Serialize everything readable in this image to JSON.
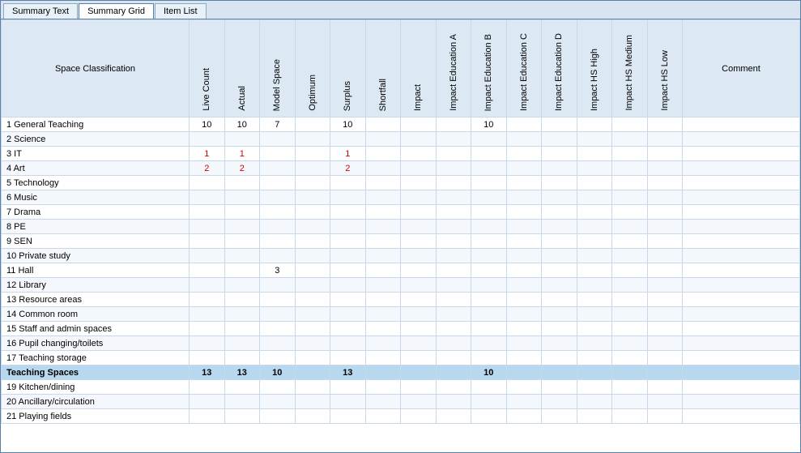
{
  "tabs": [
    {
      "label": "Summary Text",
      "active": false
    },
    {
      "label": "Summary Grid",
      "active": true
    },
    {
      "label": "Item List",
      "active": false
    }
  ],
  "table": {
    "headers": {
      "space_classification": "Space Classification",
      "live_count": "Live Count",
      "actual": "Actual",
      "model_space": "Model Space",
      "optimum": "Optimum",
      "surplus": "Surplus",
      "shortfall": "Shortfall",
      "impact": "Impact",
      "impact_edu_a": "Impact Education A",
      "impact_edu_b": "Impact Education B",
      "impact_edu_c": "Impact Education C",
      "impact_edu_d": "Impact Education D",
      "impact_hs_high": "Impact HS High",
      "impact_hs_medium": "Impact HS Medium",
      "impact_hs_low": "Impact HS Low",
      "comment": "Comment"
    },
    "rows": [
      {
        "id": "1",
        "label": "1 General Teaching",
        "live_count": "10",
        "actual": "10",
        "model_space": "7",
        "optimum": "",
        "surplus": "10",
        "shortfall": "",
        "impact": "",
        "edu_a": "",
        "edu_b": "10",
        "edu_c": "",
        "edu_d": "",
        "hs_high": "",
        "hs_medium": "",
        "hs_low": "",
        "comment": "",
        "highlight": false,
        "red": false
      },
      {
        "id": "2",
        "label": "2 Science",
        "live_count": "",
        "actual": "",
        "model_space": "",
        "optimum": "",
        "surplus": "",
        "shortfall": "",
        "impact": "",
        "edu_a": "",
        "edu_b": "",
        "edu_c": "",
        "edu_d": "",
        "hs_high": "",
        "hs_medium": "",
        "hs_low": "",
        "comment": "",
        "highlight": false
      },
      {
        "id": "3",
        "label": "3 IT",
        "live_count": "1",
        "actual": "1",
        "model_space": "",
        "optimum": "",
        "surplus": "1",
        "shortfall": "",
        "impact": "",
        "edu_a": "",
        "edu_b": "",
        "edu_c": "",
        "edu_d": "",
        "hs_high": "",
        "hs_medium": "",
        "hs_low": "",
        "comment": "",
        "highlight": false,
        "red": true
      },
      {
        "id": "4",
        "label": "4 Art",
        "live_count": "2",
        "actual": "2",
        "model_space": "",
        "optimum": "",
        "surplus": "2",
        "shortfall": "",
        "impact": "",
        "edu_a": "",
        "edu_b": "",
        "edu_c": "",
        "edu_d": "",
        "hs_high": "",
        "hs_medium": "",
        "hs_low": "",
        "comment": "",
        "highlight": false,
        "red": true
      },
      {
        "id": "5",
        "label": "5 Technology",
        "live_count": "",
        "actual": "",
        "model_space": "",
        "optimum": "",
        "surplus": "",
        "shortfall": "",
        "impact": "",
        "edu_a": "",
        "edu_b": "",
        "edu_c": "",
        "edu_d": "",
        "hs_high": "",
        "hs_medium": "",
        "hs_low": "",
        "comment": "",
        "highlight": false
      },
      {
        "id": "6",
        "label": "6 Music",
        "live_count": "",
        "actual": "",
        "model_space": "",
        "optimum": "",
        "surplus": "",
        "shortfall": "",
        "impact": "",
        "edu_a": "",
        "edu_b": "",
        "edu_c": "",
        "edu_d": "",
        "hs_high": "",
        "hs_medium": "",
        "hs_low": "",
        "comment": "",
        "highlight": false
      },
      {
        "id": "7",
        "label": "7 Drama",
        "live_count": "",
        "actual": "",
        "model_space": "",
        "optimum": "",
        "surplus": "",
        "shortfall": "",
        "impact": "",
        "edu_a": "",
        "edu_b": "",
        "edu_c": "",
        "edu_d": "",
        "hs_high": "",
        "hs_medium": "",
        "hs_low": "",
        "comment": "",
        "highlight": false
      },
      {
        "id": "8",
        "label": "8 PE",
        "live_count": "",
        "actual": "",
        "model_space": "",
        "optimum": "",
        "surplus": "",
        "shortfall": "",
        "impact": "",
        "edu_a": "",
        "edu_b": "",
        "edu_c": "",
        "edu_d": "",
        "hs_high": "",
        "hs_medium": "",
        "hs_low": "",
        "comment": "",
        "highlight": false
      },
      {
        "id": "9",
        "label": "9 SEN",
        "live_count": "",
        "actual": "",
        "model_space": "",
        "optimum": "",
        "surplus": "",
        "shortfall": "",
        "impact": "",
        "edu_a": "",
        "edu_b": "",
        "edu_c": "",
        "edu_d": "",
        "hs_high": "",
        "hs_medium": "",
        "hs_low": "",
        "comment": "",
        "highlight": false
      },
      {
        "id": "10",
        "label": "10 Private study",
        "live_count": "",
        "actual": "",
        "model_space": "",
        "optimum": "",
        "surplus": "",
        "shortfall": "",
        "impact": "",
        "edu_a": "",
        "edu_b": "",
        "edu_c": "",
        "edu_d": "",
        "hs_high": "",
        "hs_medium": "",
        "hs_low": "",
        "comment": "",
        "highlight": false
      },
      {
        "id": "11",
        "label": "11 Hall",
        "live_count": "",
        "actual": "",
        "model_space": "3",
        "optimum": "",
        "surplus": "",
        "shortfall": "",
        "impact": "",
        "edu_a": "",
        "edu_b": "",
        "edu_c": "",
        "edu_d": "",
        "hs_high": "",
        "hs_medium": "",
        "hs_low": "",
        "comment": "",
        "highlight": false
      },
      {
        "id": "12",
        "label": "12 Library",
        "live_count": "",
        "actual": "",
        "model_space": "",
        "optimum": "",
        "surplus": "",
        "shortfall": "",
        "impact": "",
        "edu_a": "",
        "edu_b": "",
        "edu_c": "",
        "edu_d": "",
        "hs_high": "",
        "hs_medium": "",
        "hs_low": "",
        "comment": "",
        "highlight": false
      },
      {
        "id": "13",
        "label": "13 Resource areas",
        "live_count": "",
        "actual": "",
        "model_space": "",
        "optimum": "",
        "surplus": "",
        "shortfall": "",
        "impact": "",
        "edu_a": "",
        "edu_b": "",
        "edu_c": "",
        "edu_d": "",
        "hs_high": "",
        "hs_medium": "",
        "hs_low": "",
        "comment": "",
        "highlight": false
      },
      {
        "id": "14",
        "label": "14 Common room",
        "live_count": "",
        "actual": "",
        "model_space": "",
        "optimum": "",
        "surplus": "",
        "shortfall": "",
        "impact": "",
        "edu_a": "",
        "edu_b": "",
        "edu_c": "",
        "edu_d": "",
        "hs_high": "",
        "hs_medium": "",
        "hs_low": "",
        "comment": "",
        "highlight": false
      },
      {
        "id": "15",
        "label": "15 Staff and admin spaces",
        "live_count": "",
        "actual": "",
        "model_space": "",
        "optimum": "",
        "surplus": "",
        "shortfall": "",
        "impact": "",
        "edu_a": "",
        "edu_b": "",
        "edu_c": "",
        "edu_d": "",
        "hs_high": "",
        "hs_medium": "",
        "hs_low": "",
        "comment": "",
        "highlight": false
      },
      {
        "id": "16",
        "label": "16 Pupil changing/toilets",
        "live_count": "",
        "actual": "",
        "model_space": "",
        "optimum": "",
        "surplus": "",
        "shortfall": "",
        "impact": "",
        "edu_a": "",
        "edu_b": "",
        "edu_c": "",
        "edu_d": "",
        "hs_high": "",
        "hs_medium": "",
        "hs_low": "",
        "comment": "",
        "highlight": false
      },
      {
        "id": "17",
        "label": "17 Teaching storage",
        "live_count": "",
        "actual": "",
        "model_space": "",
        "optimum": "",
        "surplus": "",
        "shortfall": "",
        "impact": "",
        "edu_a": "",
        "edu_b": "",
        "edu_c": "",
        "edu_d": "",
        "hs_high": "",
        "hs_medium": "",
        "hs_low": "",
        "comment": "",
        "highlight": false
      },
      {
        "id": "ts",
        "label": "Teaching Spaces",
        "live_count": "13",
        "actual": "13",
        "model_space": "10",
        "optimum": "",
        "surplus": "13",
        "shortfall": "",
        "impact": "",
        "edu_a": "",
        "edu_b": "10",
        "edu_c": "",
        "edu_d": "",
        "hs_high": "",
        "hs_medium": "",
        "hs_low": "",
        "comment": "",
        "highlight": true
      },
      {
        "id": "19",
        "label": "19 Kitchen/dining",
        "live_count": "",
        "actual": "",
        "model_space": "",
        "optimum": "",
        "surplus": "",
        "shortfall": "",
        "impact": "",
        "edu_a": "",
        "edu_b": "",
        "edu_c": "",
        "edu_d": "",
        "hs_high": "",
        "hs_medium": "",
        "hs_low": "",
        "comment": "",
        "highlight": false
      },
      {
        "id": "20",
        "label": "20 Ancillary/circulation",
        "live_count": "",
        "actual": "",
        "model_space": "",
        "optimum": "",
        "surplus": "",
        "shortfall": "",
        "impact": "",
        "edu_a": "",
        "edu_b": "",
        "edu_c": "",
        "edu_d": "",
        "hs_high": "",
        "hs_medium": "",
        "hs_low": "",
        "comment": "",
        "highlight": false
      },
      {
        "id": "21",
        "label": "21 Playing fields",
        "live_count": "",
        "actual": "",
        "model_space": "",
        "optimum": "",
        "surplus": "",
        "shortfall": "",
        "impact": "",
        "edu_a": "",
        "edu_b": "",
        "edu_c": "",
        "edu_d": "",
        "hs_high": "",
        "hs_medium": "",
        "hs_low": "",
        "comment": "",
        "highlight": false
      }
    ]
  }
}
